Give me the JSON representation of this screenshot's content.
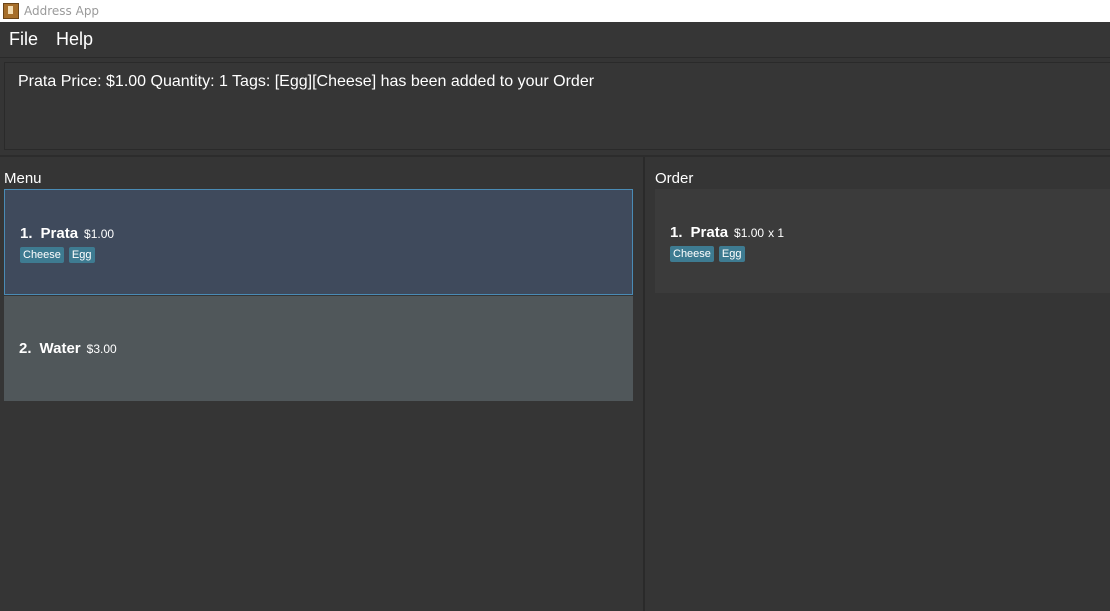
{
  "window": {
    "title": "Address App"
  },
  "menubar": {
    "items": [
      "File",
      "Help"
    ]
  },
  "result": {
    "message": "Prata Price: $1.00 Quantity: 1 Tags: [Egg][Cheese] has been added to your Order"
  },
  "menu": {
    "title": "Menu",
    "items": [
      {
        "index": "1.",
        "name": "Prata",
        "price": "$1.00",
        "tags": [
          "Cheese",
          "Egg"
        ],
        "selected": true
      },
      {
        "index": "2.",
        "name": "Water",
        "price": "$3.00",
        "tags": [],
        "selected": false
      }
    ]
  },
  "order": {
    "title": "Order",
    "items": [
      {
        "index": "1.",
        "name": "Prata",
        "price": "$1.00",
        "quantity": "x 1",
        "tags": [
          "Cheese",
          "Egg"
        ]
      }
    ]
  },
  "colors": {
    "background": "#353535",
    "selected_card": "#3f4a5c",
    "unselected_card": "#50575a",
    "order_card": "#3b3b3b",
    "tag": "#3e7b91"
  }
}
